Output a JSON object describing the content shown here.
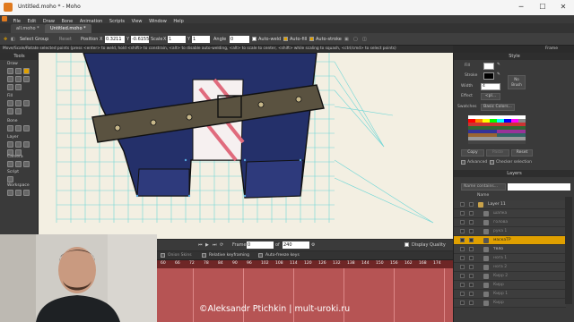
{
  "window": {
    "title": "Untitled.moho * - Moho",
    "min": "─",
    "max": "☐",
    "close": "✕"
  },
  "menu": [
    "File",
    "Edit",
    "Draw",
    "Bone",
    "Animation",
    "Scripts",
    "View",
    "Window",
    "Help"
  ],
  "tabs": [
    "all.moho *",
    "Untitled.moho *"
  ],
  "toolbar": {
    "select_group": "Select Group",
    "reset": "Reset",
    "position_label": "Position",
    "pos_x_label": "X",
    "pos_x": "0.3211",
    "pos_y_label": "Y",
    "pos_y": "-0.6155",
    "scale_label": "Scale",
    "scale_x_label": "X",
    "scale_x": "1",
    "scale_y_label": "Y",
    "scale_y": "1",
    "angle_label": "Angle",
    "angle": "0",
    "auto_weld": "Auto-weld",
    "auto_fill": "Auto-fill",
    "auto_stroke": "Auto-stroke"
  },
  "status": "Move/Scale/Rotate selected points (press <enter> to weld, hold <shift> to constrain, <alt> to disable auto-welding, <alt> to scale to center, <shift> while scaling to squash, <ctrl/cmd> to select points)",
  "frame_label": "Frame",
  "tools": {
    "title": "Tools",
    "sections": [
      "Draw",
      "Fill",
      "Bone",
      "Layer",
      "Camera",
      "Script",
      "Workspace"
    ]
  },
  "timeline": {
    "frame_label": "Frame",
    "frame_value": "0",
    "of_label": "of",
    "end_value": "240",
    "display_quality": "Display Quality",
    "onion_skins": "Onion Skins",
    "relative_keyframing": "Relative keyframing",
    "auto_freeze_keys": "Auto-freeze keys",
    "ruler": [
      "60",
      "66",
      "72",
      "78",
      "84",
      "90",
      "96",
      "102",
      "108",
      "114",
      "120",
      "126",
      "132",
      "138",
      "144",
      "150",
      "156",
      "162",
      "168",
      "174"
    ]
  },
  "watermark": "©Aleksandr Ptichkin | mult-uroki.ru",
  "style": {
    "title": "Style",
    "fill_label": "Fill",
    "stroke_label": "Stroke",
    "no_brush": "No Brush",
    "width_label": "Width",
    "width_value": "4",
    "effect_label": "Effect",
    "effect_value": "<pl...",
    "swatches_label": "Swatches",
    "swatches_value": "Basic Colors...",
    "copy": "Copy",
    "paste": "Paste",
    "reset": "Reset",
    "advanced": "Advanced",
    "checker": "Checker selection"
  },
  "layers": {
    "title": "Layers",
    "filter_placeholder": "Name contains...",
    "name_col": "Name",
    "items": [
      {
        "name": "Layer 11",
        "state": "normal"
      },
      {
        "name": "шапка",
        "state": "dim"
      },
      {
        "name": "голова",
        "state": "dim"
      },
      {
        "name": "рука 1",
        "state": "dim"
      },
      {
        "name": "маскаТР",
        "state": "selected"
      },
      {
        "name": "тело",
        "state": "normal"
      },
      {
        "name": "нога 1",
        "state": "dim"
      },
      {
        "name": "нога 2",
        "state": "dim"
      },
      {
        "name": "Кирр 2",
        "state": "dim"
      },
      {
        "name": "Кирр",
        "state": "dim"
      },
      {
        "name": "Кирр 1",
        "state": "dim"
      },
      {
        "name": "Кирр",
        "state": "dim"
      }
    ]
  },
  "colors": {
    "accent": "#e0a000",
    "timeline": "#b65454",
    "brand": "#e07a1f"
  }
}
